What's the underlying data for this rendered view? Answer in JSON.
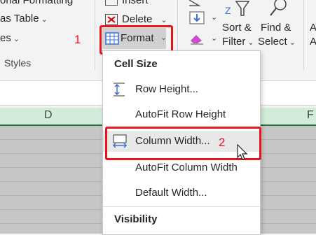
{
  "ribbon": {
    "conditional_formatting_partial": "onal Formatting",
    "format_as_table_partial": "as Table",
    "cell_styles_partial": "es",
    "styles_group_label": "Styles",
    "insert_partial": "Insert",
    "delete_label": "Delete",
    "format_label": "Format",
    "sort_filter_line1": "Sort &",
    "sort_filter_line2": "Filter",
    "find_select_line1": "Find &",
    "find_select_line2": "Select",
    "edge_letter_a1": "A",
    "edge_letter_a2": "A"
  },
  "columns": {
    "d": "D",
    "f": "F"
  },
  "annotations": {
    "step1": "1",
    "step2": "2"
  },
  "menu": {
    "cell_size_header": "Cell Size",
    "row_height": "Row Height...",
    "autofit_row_height": "AutoFit Row Height",
    "column_width": "Column Width...",
    "autofit_column_width": "AutoFit Column Width",
    "default_width": "Default Width...",
    "visibility_header": "Visibility"
  },
  "colors": {
    "highlight_red": "#e8141e",
    "column_header_green": "#d3ecd9",
    "excel_green": "#217346"
  },
  "icons": [
    "insert-icon",
    "delete-icon",
    "format-icon",
    "sort-icon",
    "filter-icon",
    "find-icon",
    "row-height-icon",
    "column-width-icon",
    "eraser-icon",
    "fill-down-icon",
    "autosum-icon",
    "mouse-cursor-icon"
  ]
}
